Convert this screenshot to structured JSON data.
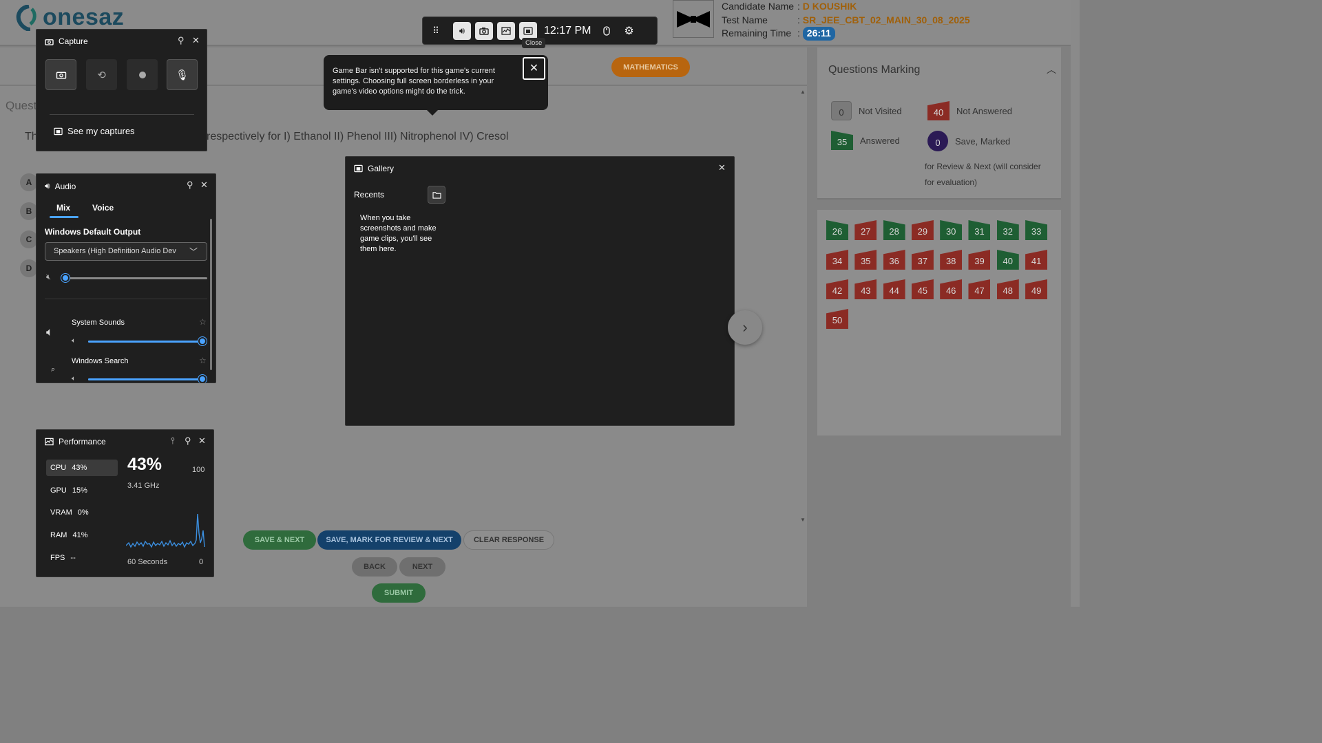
{
  "exam": {
    "logo_text": "onesaz",
    "candidate_label": "Candidate Name",
    "candidate_value": "D KOUSHIK",
    "test_label": "Test Name",
    "test_value": "SR_JEE_CBT_02_MAIN_30_08_2025",
    "remaining_label": "Remaining Time",
    "remaining_value": "26:11",
    "sep": ":",
    "subject": "MATHEMATICS",
    "question_label": "Quest",
    "question_text_start": "Th",
    "question_text": "respectively for I) Ethanol II) Phenol III) Nitrophenol IV) Cresol",
    "options": [
      "A",
      "B",
      "C",
      "D"
    ],
    "buttons": {
      "save_next": "SAVE & NEXT",
      "save_mark": "SAVE, MARK FOR REVIEW & NEXT",
      "clear": "CLEAR RESPONSE",
      "back": "BACK",
      "next": "NEXT",
      "submit": "SUBMIT"
    },
    "marking": {
      "title": "Questions Marking",
      "not_visited_count": "0",
      "not_visited_label": "Not Visited",
      "not_answered_count": "40",
      "not_answered_label": "Not Answered",
      "answered_count": "35",
      "answered_label": "Answered",
      "marked_count": "0",
      "marked_label": "Save, Marked",
      "marked_note": "for Review & Next (will consider for evaluation)"
    },
    "questions": [
      {
        "n": "26",
        "s": "green"
      },
      {
        "n": "27",
        "s": "red"
      },
      {
        "n": "28",
        "s": "green"
      },
      {
        "n": "29",
        "s": "red"
      },
      {
        "n": "30",
        "s": "green"
      },
      {
        "n": "31",
        "s": "green"
      },
      {
        "n": "32",
        "s": "green"
      },
      {
        "n": "33",
        "s": "green"
      },
      {
        "n": "34",
        "s": "red"
      },
      {
        "n": "35",
        "s": "red"
      },
      {
        "n": "36",
        "s": "red"
      },
      {
        "n": "37",
        "s": "red"
      },
      {
        "n": "38",
        "s": "red"
      },
      {
        "n": "39",
        "s": "red"
      },
      {
        "n": "40",
        "s": "green"
      },
      {
        "n": "41",
        "s": "red"
      },
      {
        "n": "42",
        "s": "red"
      },
      {
        "n": "43",
        "s": "red"
      },
      {
        "n": "44",
        "s": "red"
      },
      {
        "n": "45",
        "s": "red"
      },
      {
        "n": "46",
        "s": "red"
      },
      {
        "n": "47",
        "s": "red"
      },
      {
        "n": "48",
        "s": "red"
      },
      {
        "n": "49",
        "s": "red"
      },
      {
        "n": "50",
        "s": "red"
      }
    ]
  },
  "gamebar": {
    "time": "12:17 PM",
    "close_tooltip": "Close",
    "notice": "Game Bar isn't supported for this game's current settings. Choosing full screen borderless in your game's video options might do the trick.",
    "capture": {
      "title": "Capture",
      "see_captures": "See my captures"
    },
    "audio": {
      "title": "Audio",
      "tab_mix": "Mix",
      "tab_voice": "Voice",
      "output_heading": "Windows Default Output",
      "device": "Speakers (High Definition Audio Dev",
      "master_volume": 0,
      "apps": [
        {
          "name": "System Sounds",
          "volume": 100
        },
        {
          "name": "Windows Search",
          "volume": 100
        }
      ]
    },
    "gallery": {
      "title": "Gallery",
      "recents": "Recents",
      "empty": "When you take screenshots and make game clips, you'll see them here."
    },
    "performance": {
      "title": "Performance",
      "rows": [
        {
          "label": "CPU",
          "value": "43%"
        },
        {
          "label": "GPU",
          "value": "15%"
        },
        {
          "label": "VRAM",
          "value": "0%"
        },
        {
          "label": "RAM",
          "value": "41%"
        },
        {
          "label": "FPS",
          "value": "--"
        }
      ],
      "big_value": "43%",
      "freq": "3.41 GHz",
      "max": "100",
      "window": "60 Seconds",
      "min": "0"
    }
  }
}
